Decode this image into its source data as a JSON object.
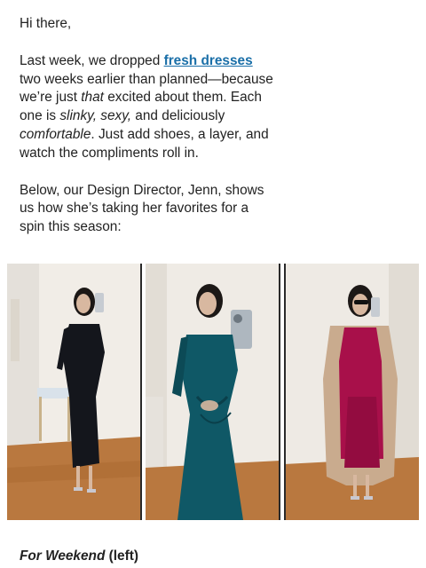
{
  "email": {
    "greeting": "Hi there,",
    "intro_before_link": "Last week, we dropped ",
    "intro_link": "fresh dresses",
    "intro_after_link_1": " two weeks earlier than planned—because we’re just ",
    "intro_em_that": "that",
    "intro_after_that": " excited about them. Each one is ",
    "intro_em_slinky": "slinky, sexy,",
    "intro_after_slinky": " and deliciously ",
    "intro_em_comfortable": "comfortable",
    "intro_after_comfortable": ". Just add shoes, a layer, and watch the compliments roll in.",
    "director_paragraph": "Below, our Design Director, Jenn, shows us how she’s taking her favorites for a spin this season:",
    "caption_title": "For Weekend",
    "caption_position": " (left)"
  },
  "photos": [
    {
      "subject": "black midi dress mirror selfie",
      "dress_color": "#14161c"
    },
    {
      "subject": "teal draped dress mirror selfie",
      "dress_color": "#0f5866"
    },
    {
      "subject": "magenta slip dress with camel coat mirror selfie",
      "dress_color": "#a8104a",
      "coat_color": "#c9ab8e"
    }
  ],
  "colors": {
    "link": "#1a6fa8",
    "text": "#222222",
    "floor": "#b9783f",
    "wall": "#eeeae4"
  }
}
